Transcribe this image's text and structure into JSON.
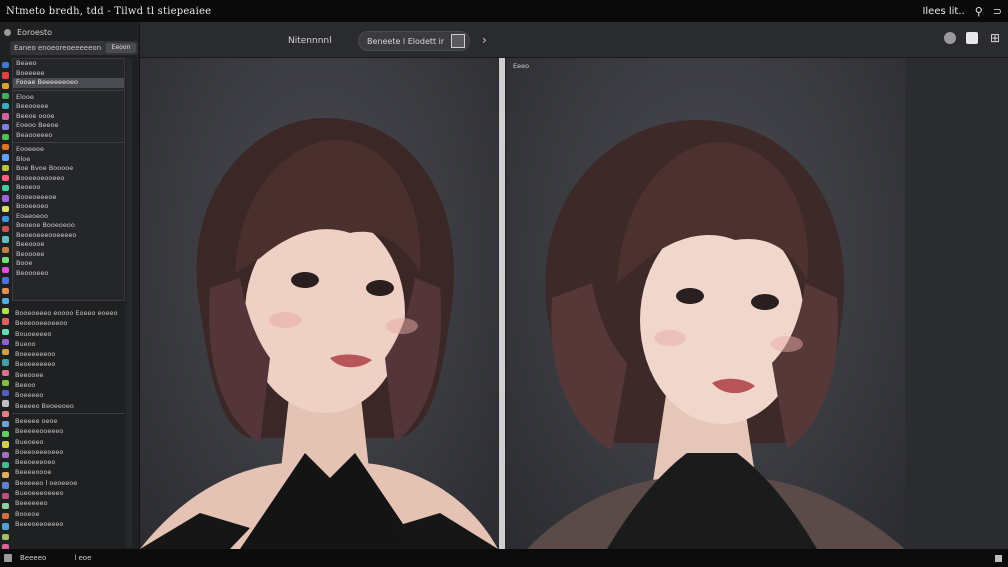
{
  "titlebar": {
    "title": "Ntmeto bredh,  tdd  -  Tilwd tl stiepeaiee",
    "right_text": "Ilees lit..",
    "right_glyph_a": "⚲",
    "right_glyph_b": "⊃"
  },
  "toolbar": {
    "label": "Nitennnnl",
    "pill_text": "Beneete l Elodett ir",
    "chevron": "›",
    "right_icons": [
      "settings-icon",
      "square-icon",
      "grid-icon"
    ]
  },
  "left_panel": {
    "header": "Eoroesto",
    "search_text": "Eaneo enoeoreoeeeeeon",
    "search_button": "Eeoon",
    "dropdown_items": [
      "Beaeo",
      "Boeeeee",
      "Fooae Beeeeeeoeo",
      "",
      "Elooe",
      "Beeooeee",
      "Beeoe oooe",
      "Eoeoo Beeoe",
      "Beaooeeeo",
      "",
      "Eooeeoe",
      "Bloe",
      "Boe Bvoe Booooe",
      "Booeeoeooeeo",
      "Beoeoo",
      "Booeoeeeoe",
      "Booeeoeo",
      "Eoaeoeoo",
      "Beoeoe Booeoeoo",
      "Beoeoeeeooeeeeo",
      "Beeoooe",
      "Beoooee",
      "Booe",
      "Beoooeeo"
    ],
    "dropdown_selected_index": 2,
    "list_items": [
      "Booeoeeeo eoooo Eoeeo eoeeo",
      "Beoeooeeoeeoo",
      "Bouoeeeeo",
      "Bueoo",
      "Boeeeeeeoo",
      "Beoeeeeeeo",
      "Beeooee",
      "Beeoo",
      "Boeeeeo",
      "Beeeeo Beoeeoeo",
      "",
      "Beeeee oeoe",
      "Beeeeeooeeeo",
      "Bueoeeo",
      "Boeeoeeeoeeo",
      "Beeoeeeoeo",
      "Beeeeoooe",
      "Beoeeeo l oeoeeoe",
      "Bueoeeeoeeeo",
      "Beeeeeeo",
      "Booeoe",
      "Beeeoeeoeeeo"
    ],
    "swatch_colors": [
      "#3a7bd5",
      "#e04040",
      "#e0a030",
      "#40b060",
      "#30b0c0",
      "#d060a0",
      "#8080e0",
      "#50c050",
      "#e07020",
      "#60a0ff",
      "#c0c040",
      "#ff6080",
      "#40d0a0",
      "#a060e0",
      "#e0e060",
      "#4090e0",
      "#d05050",
      "#60c0c0",
      "#c08040",
      "#70e070",
      "#e050e0",
      "#5070e0",
      "#e09050",
      "#50b0e0",
      "#b0e050",
      "#e06060",
      "#60e0b0",
      "#9060d0",
      "#d0a040",
      "#40a0a0",
      "#e07090",
      "#80c040",
      "#5060c0",
      "#c0c0c0",
      "#e08080",
      "#70a0e0",
      "#60d060",
      "#d0d050",
      "#a070c0",
      "#40c090",
      "#e0b060",
      "#6080d0",
      "#c05080",
      "#90d0a0",
      "#d07040",
      "#50a0d0",
      "#a0c060",
      "#e060a0"
    ]
  },
  "canvas": {
    "left_pane_label": "",
    "right_pane_label": "Eeeo",
    "left_image": "portrait-left",
    "right_image": "portrait-right"
  },
  "statusbar": {
    "text": "Beeeeo",
    "center": "l eoe"
  },
  "colors": {
    "titlebar_bg": "#0a0a0a",
    "toolbar_bg": "#2a2b2e",
    "panel_bg": "#1f2022",
    "canvas_bg": "#2a2b2e",
    "divider": "#cfcfcf"
  }
}
